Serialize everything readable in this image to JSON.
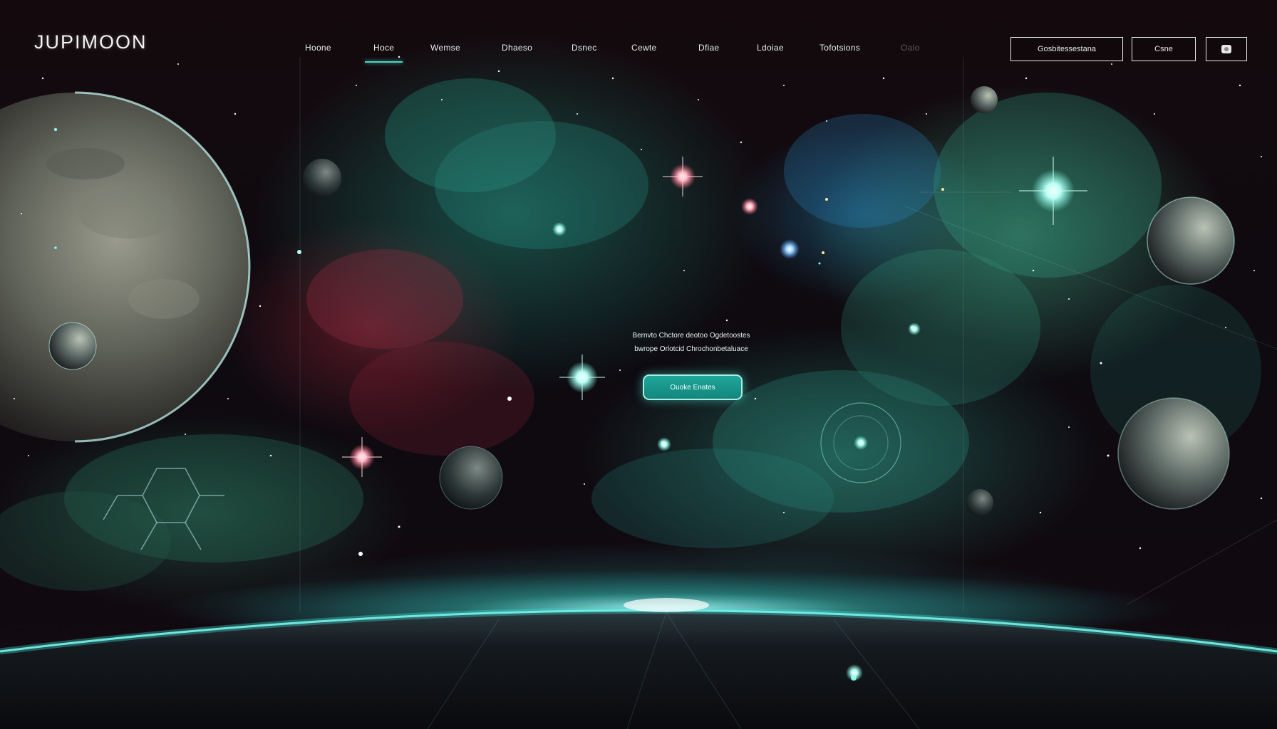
{
  "brand": {
    "logo_text": "JUPIMOON"
  },
  "nav": {
    "items": [
      {
        "label": "Hoone"
      },
      {
        "label": "Hoce"
      },
      {
        "label": "Wemse"
      },
      {
        "label": "Dhaeso"
      },
      {
        "label": "Dsnec"
      },
      {
        "label": "Cewte"
      },
      {
        "label": "Dfiae"
      },
      {
        "label": "Ldoiae"
      },
      {
        "label": "Tofotsions"
      },
      {
        "label": "Oalo"
      }
    ],
    "active_index": 1
  },
  "header_actions": {
    "primary_label": "Gosbitessestana",
    "secondary_label": "Csne",
    "user_icon": "user-icon"
  },
  "hero": {
    "line1": "Bernvto Chctore deotoo Ogdetoostes",
    "line2": "bwrope Orlotcid Chrochonbetaluace",
    "cta_label": "Ouoke Enates"
  },
  "colors": {
    "accent": "#4fd1c5",
    "cta_fill": "#1a9a8e",
    "text": "#e8e8e8"
  }
}
